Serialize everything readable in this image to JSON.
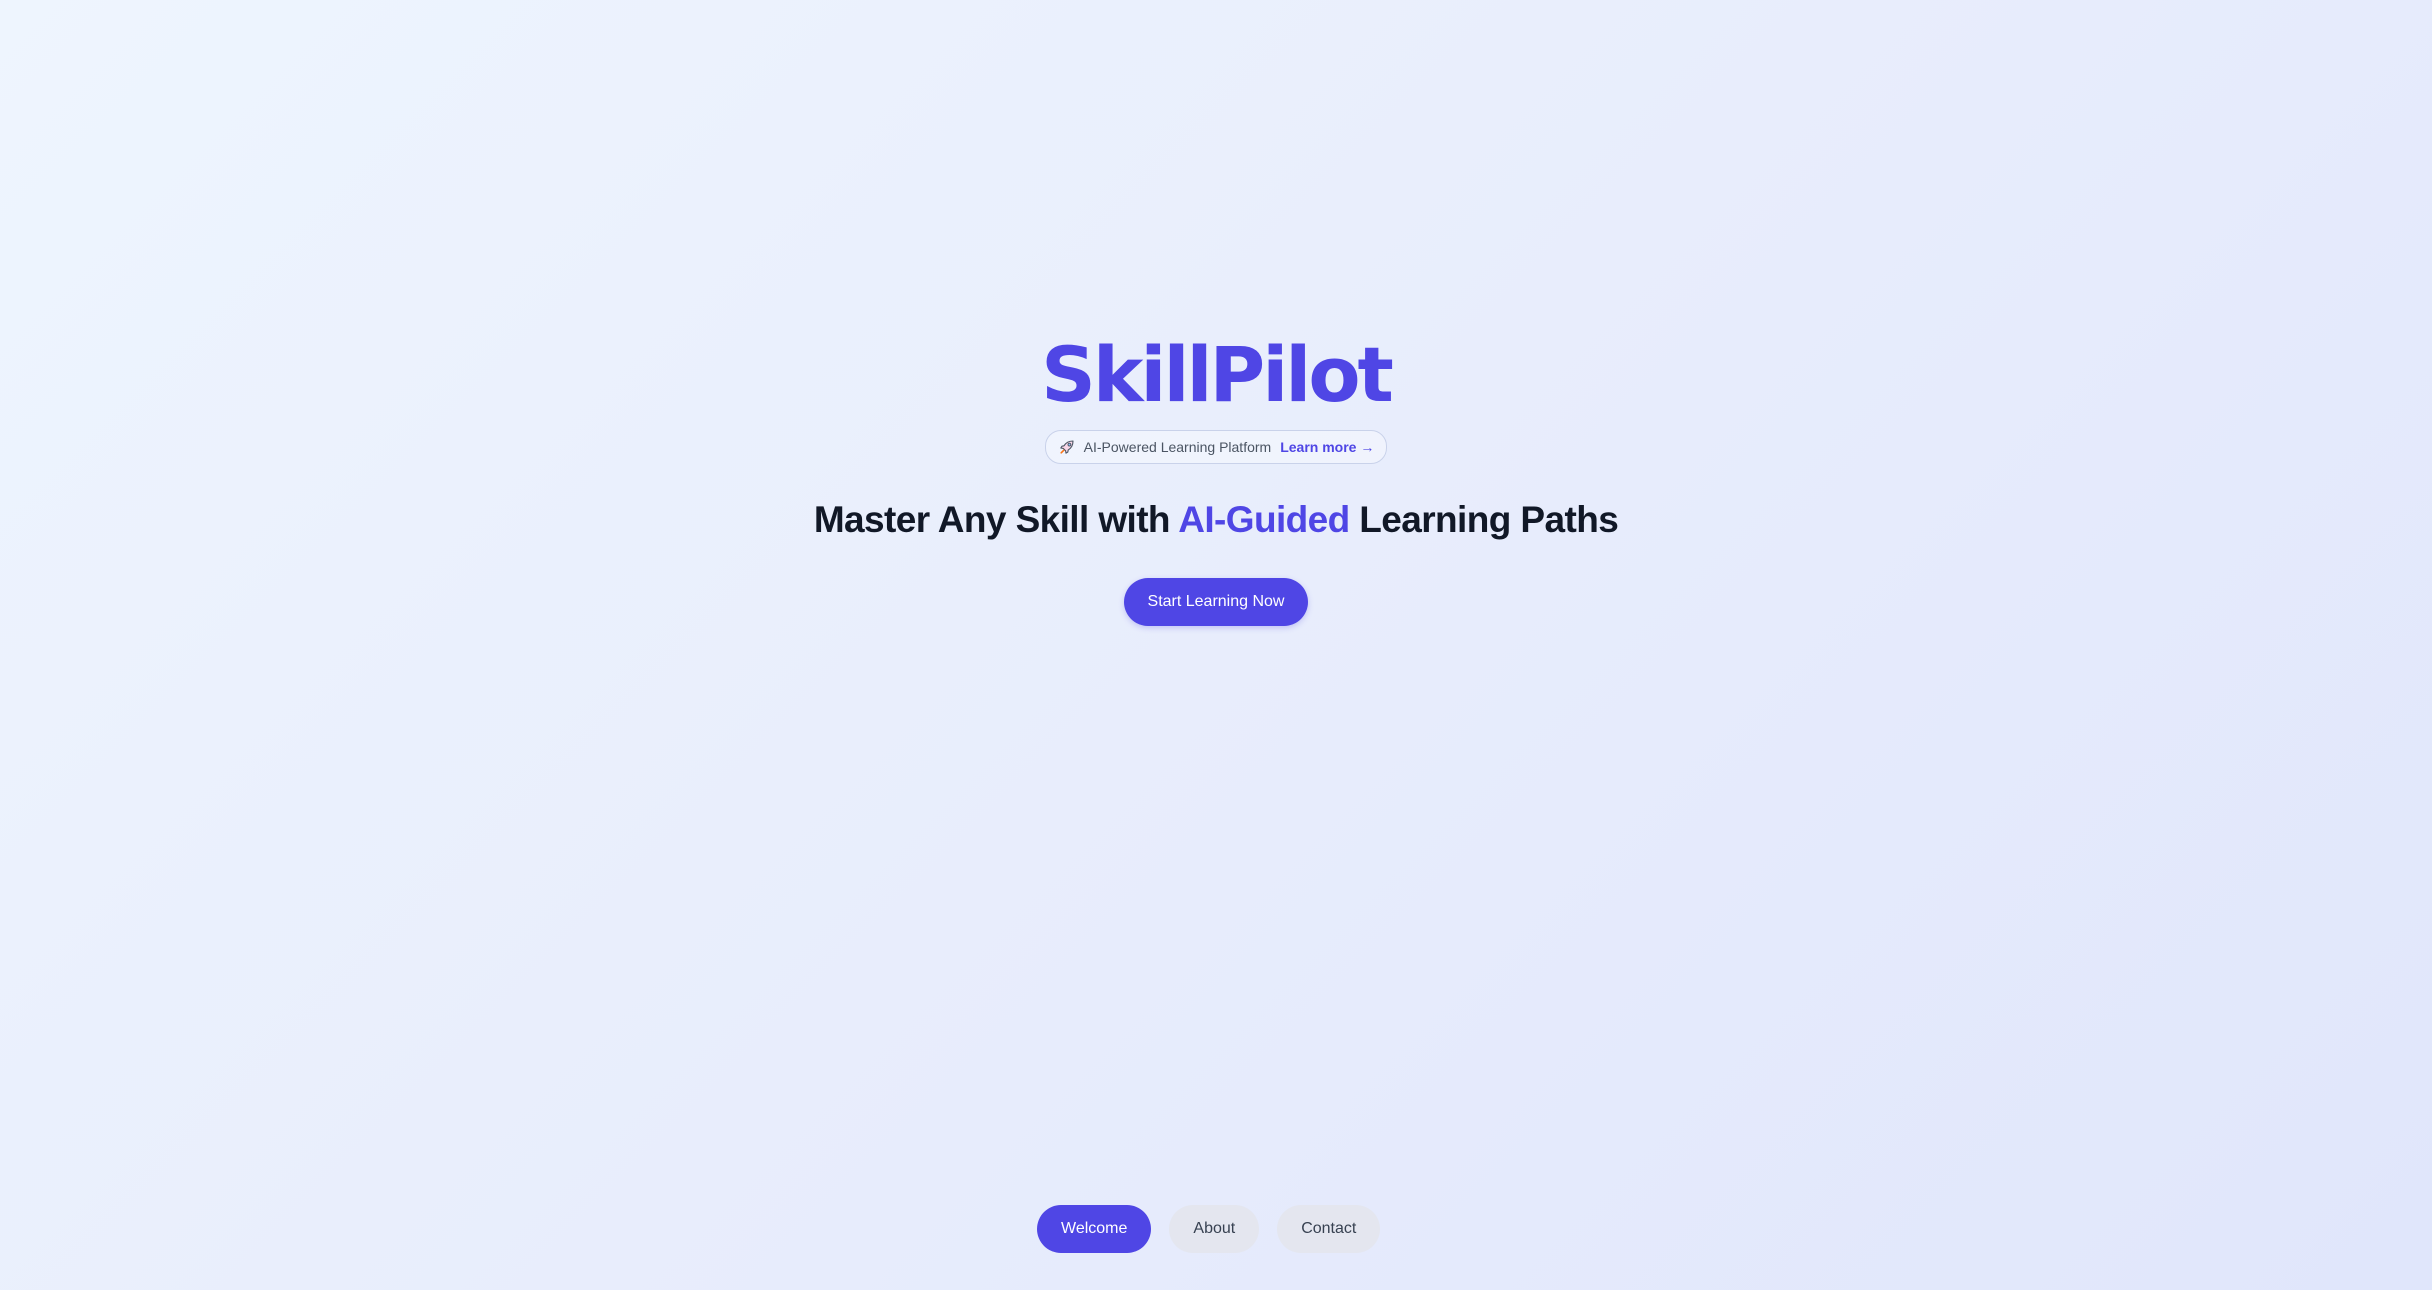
{
  "app": {
    "name": "SkillPilot"
  },
  "badge": {
    "icon": "rocket-icon",
    "text": "AI-Powered Learning Platform",
    "link_label": "Learn more →"
  },
  "hero": {
    "headline_before": "Master Any Skill with ",
    "headline_accent": "AI-Guided",
    "headline_after": " Learning Paths",
    "cta_label": "Start Learning Now"
  },
  "nav": {
    "items": [
      {
        "label": "Welcome",
        "active": true
      },
      {
        "label": "About",
        "active": false
      },
      {
        "label": "Contact",
        "active": false
      }
    ]
  },
  "colors": {
    "accent": "#4f46e5",
    "text": "#111827",
    "muted_button": "#e4e6ef"
  }
}
